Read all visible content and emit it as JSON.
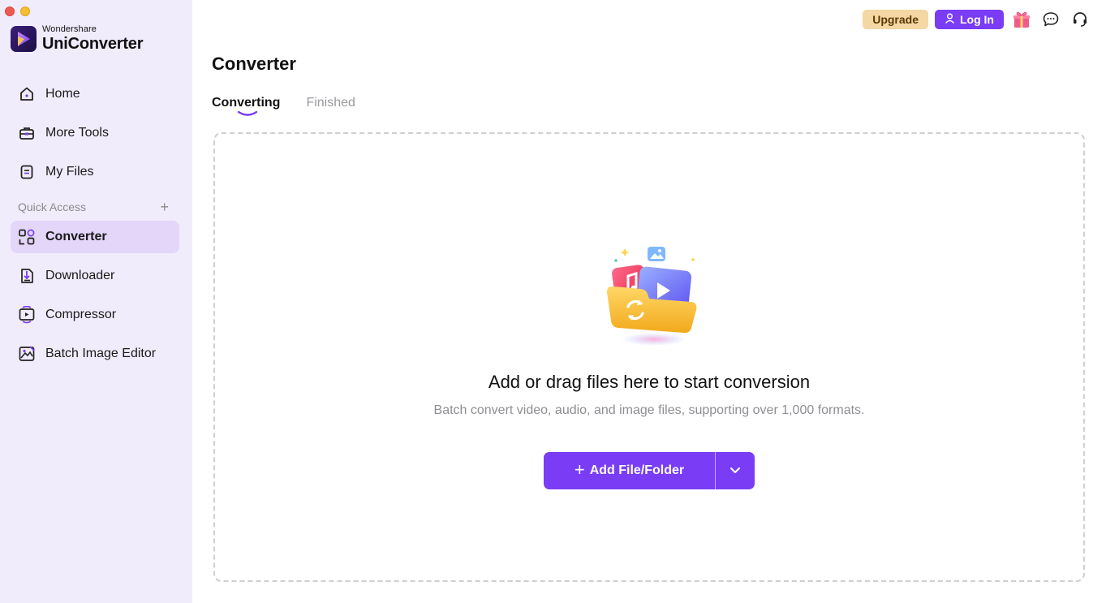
{
  "app": {
    "brand_small": "Wondershare",
    "brand_name": "UniConverter"
  },
  "sidebar": {
    "items": [
      {
        "label": "Home",
        "icon": "home-icon"
      },
      {
        "label": "More Tools",
        "icon": "toolbox-icon"
      },
      {
        "label": "My Files",
        "icon": "files-icon"
      }
    ],
    "quick_access_label": "Quick Access",
    "quick_access_add": "+",
    "quick_items": [
      {
        "label": "Converter",
        "icon": "converter-icon",
        "active": true
      },
      {
        "label": "Downloader",
        "icon": "downloader-icon"
      },
      {
        "label": "Compressor",
        "icon": "compressor-icon"
      },
      {
        "label": "Batch Image Editor",
        "icon": "batch-image-editor-icon"
      }
    ]
  },
  "topbar": {
    "upgrade_label": "Upgrade",
    "login_label": "Log In",
    "icons": [
      "gift-icon",
      "chat-icon",
      "support-headset-icon"
    ]
  },
  "main": {
    "title": "Converter",
    "tabs": [
      {
        "label": "Converting",
        "active": true
      },
      {
        "label": "Finished",
        "active": false
      }
    ],
    "dropzone": {
      "title": "Add or drag files here to start conversion",
      "subtitle": "Batch convert video, audio, and image files, supporting over 1,000 formats.",
      "add_button_label": "Add File/Folder"
    }
  },
  "colors": {
    "accent": "#7a3cf5",
    "sidebar_bg": "#f1ecfb",
    "active_item_bg": "#e3d6f9",
    "upgrade_bg": "#f4d7a2"
  }
}
